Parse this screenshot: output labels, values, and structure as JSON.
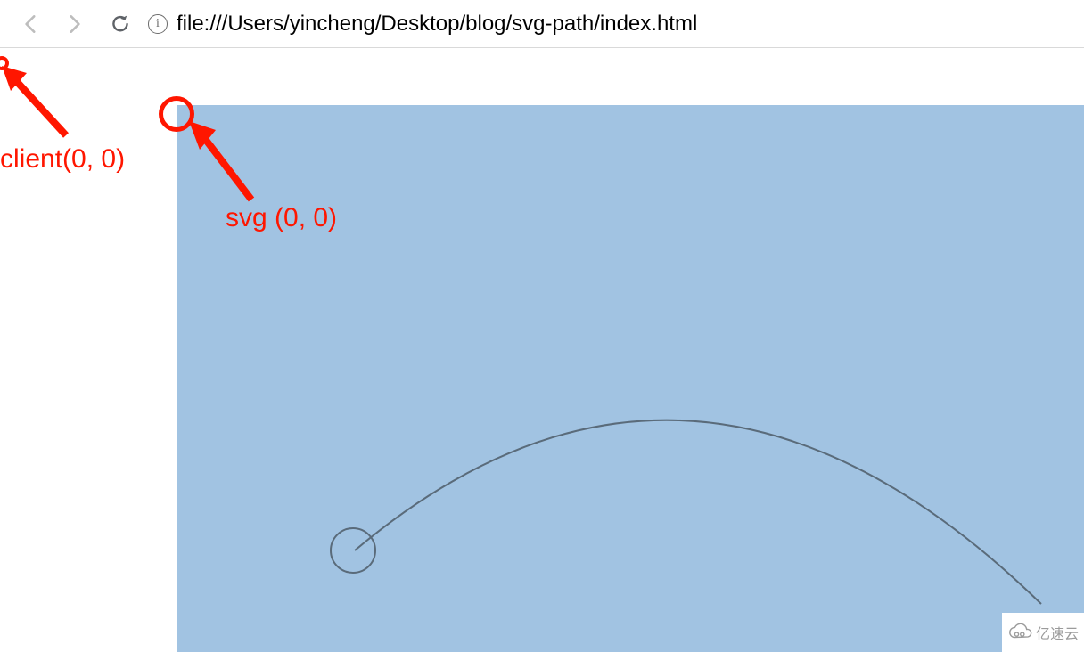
{
  "toolbar": {
    "url": "file:///Users/yincheng/Desktop/blog/svg-path/index.html",
    "info_glyph": "i"
  },
  "annotations": {
    "client_label": "client(0, 0)",
    "svg_label": "svg (0, 0)"
  },
  "colors": {
    "annotation": "#ff1600",
    "svg_bg": "#a1c3e2",
    "curve": "#5a6b7a"
  },
  "watermark": {
    "text": "亿速云"
  }
}
